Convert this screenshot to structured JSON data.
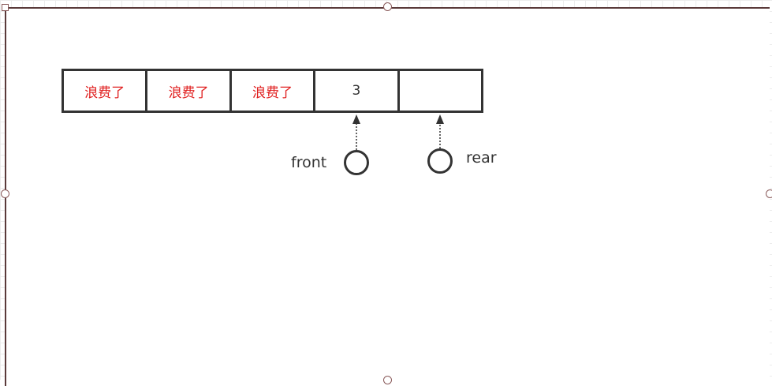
{
  "queue": {
    "cells": [
      {
        "text": "浪费了",
        "status": "wasted"
      },
      {
        "text": "浪费了",
        "status": "wasted"
      },
      {
        "text": "浪费了",
        "status": "wasted"
      },
      {
        "text": "3",
        "status": "normal"
      },
      {
        "text": "",
        "status": "empty"
      }
    ]
  },
  "pointers": {
    "front": {
      "label": "front",
      "target_index": 3
    },
    "rear": {
      "label": "rear",
      "target_index": 4
    }
  },
  "colors": {
    "wasted_text": "#e02020",
    "stroke": "#333333",
    "frame": "#5a3a3a"
  }
}
